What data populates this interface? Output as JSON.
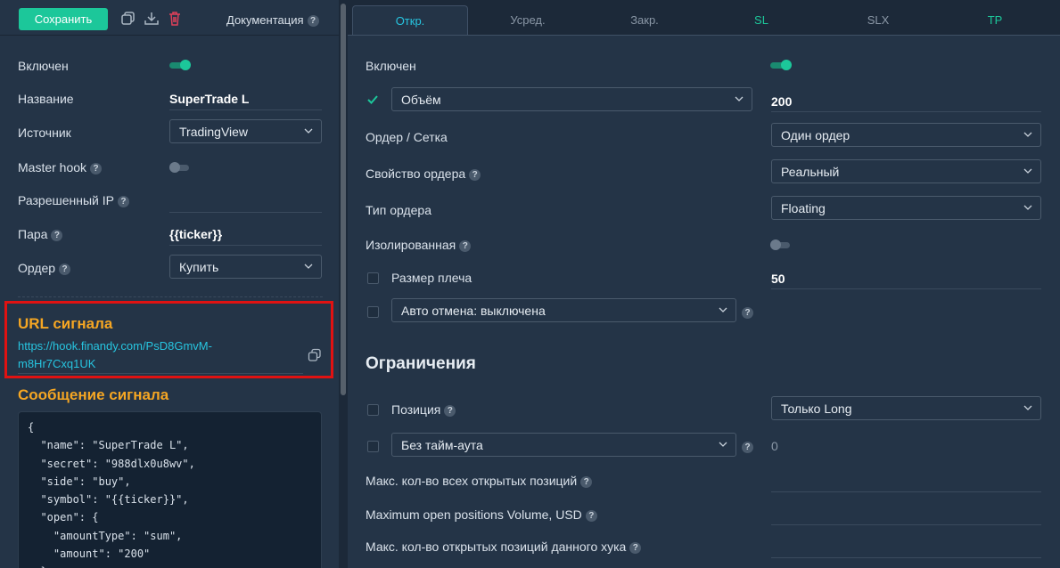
{
  "toolbar": {
    "save_label": "Сохранить",
    "doc_label": "Документация"
  },
  "left": {
    "enabled_label": "Включен",
    "name_label": "Название",
    "name_value": "SuperTrade L",
    "source_label": "Источник",
    "source_value": "TradingView",
    "masterhook_label": "Master hook",
    "allowed_ip_label": "Разрешенный IP",
    "pair_label": "Пара",
    "pair_value": "{{ticker}}",
    "order_label": "Ордер",
    "order_value": "Купить",
    "url_title": "URL сигнала",
    "url_value": "https://hook.finandy.com/PsD8GmvM-m8Hr7Cxq1UK",
    "message_title": "Сообщение сигнала",
    "message_code": "{\n  \"name\": \"SuperTrade L\",\n  \"secret\": \"988dlx0u8wv\",\n  \"side\": \"buy\",\n  \"symbol\": \"{{ticker}}\",\n  \"open\": {\n    \"amountType\": \"sum\",\n    \"amount\": \"200\"\n  },"
  },
  "tabs": [
    "Откр.",
    "Усред.",
    "Закр.",
    "SL",
    "SLX",
    "TP"
  ],
  "right": {
    "enabled_label": "Включен",
    "volume_select": "Объём",
    "volume_value": "200",
    "order_grid_label": "Ордер / Сетка",
    "order_grid_value": "Один ордер",
    "order_prop_label": "Свойство ордера",
    "order_prop_value": "Реальный",
    "order_type_label": "Тип ордера",
    "order_type_value": "Floating",
    "isolated_label": "Изолированная",
    "leverage_label": "Размер плеча",
    "leverage_value": "50",
    "auto_cancel_value": "Авто отмена: выключена",
    "limits_title": "Ограничения",
    "position_label": "Позиция",
    "position_value": "Только Long",
    "timeout_value": "Без тайм-аута",
    "timeout_number": "0",
    "max_all_label": "Макс. кол-во всех открытых позиций",
    "max_volume_label": "Maximum open positions Volume, USD",
    "max_hook_label": "Макс. кол-во открытых позиций данного хука"
  },
  "help_glyph": "?",
  "colors": {
    "accent_green": "#1cc79a",
    "accent_cyan": "#27c5e0",
    "accent_orange": "#f5a623",
    "highlight_red": "#e01212"
  }
}
